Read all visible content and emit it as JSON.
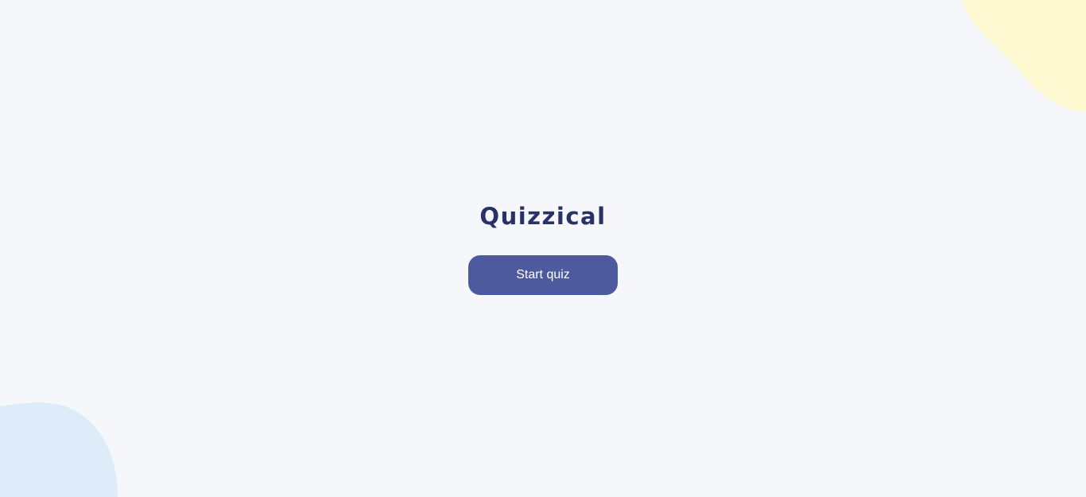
{
  "app": {
    "title": "Quizzical",
    "start_button_label": "Start quiz"
  },
  "colors": {
    "background": "#F5F7FB",
    "title": "#293264",
    "button": "#4D5B9E",
    "button_text": "#FFFFFF",
    "blob_top_right": "#FFFAD1",
    "blob_bottom_left": "#DEEBF8"
  }
}
